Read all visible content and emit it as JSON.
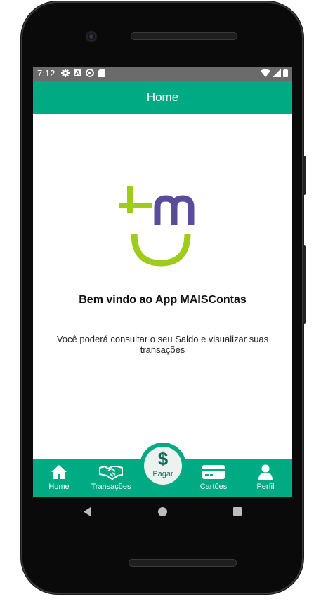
{
  "status": {
    "time": "7:12",
    "left_icons": [
      "gear-icon",
      "a-icon",
      "sync-icon",
      "sdcard-icon"
    ],
    "right_icons": [
      "wifi-icon",
      "signal-icon",
      "battery-icon"
    ]
  },
  "appbar": {
    "title": "Home"
  },
  "main": {
    "logo_name": "MAISContas logo",
    "welcome": "Bem vindo ao App MAISContas",
    "description": "Você poderá consultar o seu Saldo e visualizar suas transações"
  },
  "nav": {
    "items": [
      {
        "label": "Home",
        "icon": "home-icon"
      },
      {
        "label": "Transações",
        "icon": "handshake-icon"
      },
      {
        "label": "Pagar",
        "icon": "dollar-icon"
      },
      {
        "label": "Cartões",
        "icon": "card-icon"
      },
      {
        "label": "Perfil",
        "icon": "person-icon"
      }
    ]
  },
  "colors": {
    "primary": "#00ab84",
    "logo_green": "#9fcb1c",
    "logo_purple": "#5b4b9b"
  }
}
